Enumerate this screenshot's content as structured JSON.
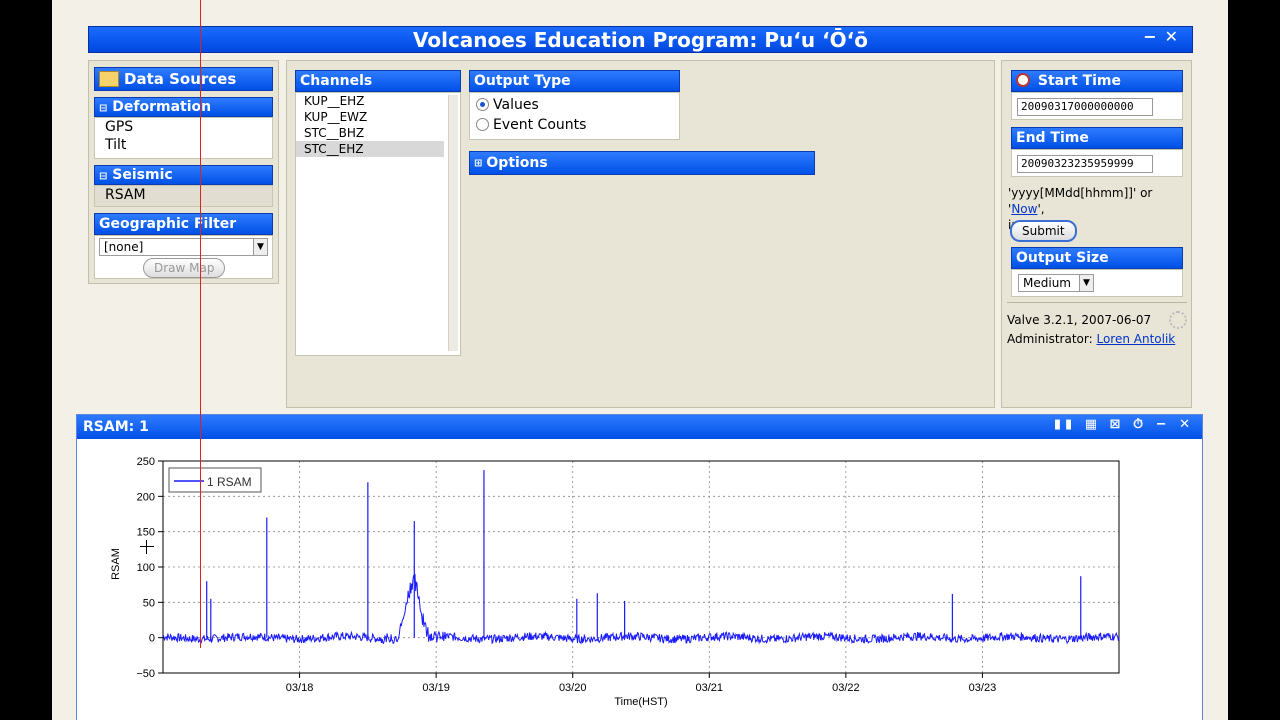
{
  "app_title": "Volcanoes Education Program: Puʻu ʻŌʻō",
  "window_controls": [
    "−",
    "✕"
  ],
  "data_sources": {
    "title": "Data Sources",
    "deformation": {
      "header": "Deformation",
      "items": [
        "GPS",
        "Tilt"
      ]
    },
    "seismic": {
      "header": "Seismic",
      "items": [
        "RSAM"
      ]
    },
    "geo_filter": {
      "header": "Geographic Filter",
      "value": "[none]",
      "draw_map": "Draw Map"
    }
  },
  "channels": {
    "header": "Channels",
    "items": [
      "KUP__EHZ",
      "KUP__EWZ",
      "STC__BHZ",
      "STC__EHZ"
    ]
  },
  "output_type": {
    "header": "Output Type",
    "values": "Values",
    "event_counts": "Event Counts"
  },
  "options": {
    "header": "Options"
  },
  "start_time": {
    "header": "Start Time",
    "value": "20090317000000000"
  },
  "end_time": {
    "header": "End Time",
    "value": "20090323235959999"
  },
  "time_hint_fmt": "'yyyy[MMdd[hhmm]]' or '",
  "time_hint_now": "Now",
  "time_hint_tail": "',",
  "time_hint_line2": "in HST.",
  "submit": "Submit",
  "output_size": {
    "header": "Output Size",
    "value": "Medium"
  },
  "version": "Valve 3.2.1, 2007-06-07",
  "admin_label": "Administrator:",
  "admin_name": "Loren Antolik",
  "plot_window_title": "RSAM: 1",
  "plot_tools": [
    "▮▮",
    "▦",
    "⊠",
    "⏱",
    "−",
    "✕"
  ],
  "chart_data": {
    "type": "line",
    "title": "",
    "xlabel": "Time(HST)",
    "ylabel": "RSAM",
    "ylim": [
      -50,
      250
    ],
    "yticks": [
      "250",
      "200",
      "150",
      "100",
      "50",
      "0",
      "−50"
    ],
    "xtick_labels": [
      "03/18",
      "03/19",
      "03/20",
      "03/21",
      "03/22",
      "03/23"
    ],
    "xlim_days": [
      17.0,
      24.0
    ],
    "grid": true,
    "legend": "top-left",
    "series": [
      {
        "name": "1 RSAM",
        "color": "#1a1aff",
        "baseline": 0,
        "spikes": [
          {
            "day": 17.32,
            "value": 80
          },
          {
            "day": 17.35,
            "value": 55
          },
          {
            "day": 17.76,
            "value": 170
          },
          {
            "day": 18.5,
            "value": 220
          },
          {
            "day": 18.84,
            "value": 165
          },
          {
            "day": 19.35,
            "value": 237
          },
          {
            "day": 20.03,
            "value": 55
          },
          {
            "day": 20.18,
            "value": 63
          },
          {
            "day": 20.38,
            "value": 52
          },
          {
            "day": 22.78,
            "value": 62
          },
          {
            "day": 23.72,
            "value": 87
          }
        ],
        "burst": {
          "center_day": 18.83,
          "peak": 80
        }
      }
    ]
  }
}
